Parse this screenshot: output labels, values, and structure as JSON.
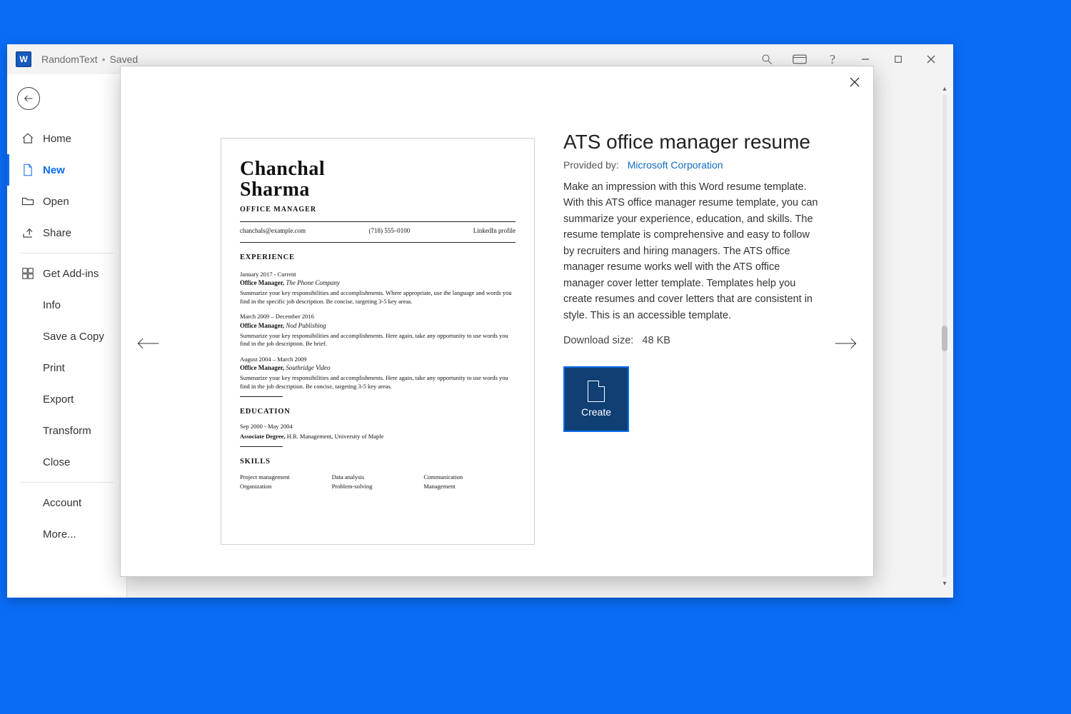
{
  "titlebar": {
    "app_initial": "W",
    "doc_name": "RandomText",
    "separator": "•",
    "save_state": "Saved"
  },
  "backstage": {
    "home": "Home",
    "new": "New",
    "open": "Open",
    "share": "Share",
    "get_addins": "Get Add-ins",
    "info": "Info",
    "save_copy": "Save a Copy",
    "print": "Print",
    "export": "Export",
    "transform": "Transform",
    "close": "Close",
    "account": "Account",
    "more": "More..."
  },
  "modal": {
    "title": "ATS office manager resume",
    "provided_label": "Provided by:",
    "provider": "Microsoft Corporation",
    "description": "Make an impression with this Word resume template. With this ATS office manager resume template, you can summarize your experience, education, and skills. The resume template is comprehensive and easy to follow by recruiters and hiring managers. The ATS office manager resume works well with the ATS office manager cover letter template. Templates help you create resumes and cover letters that are consistent in style. This is an accessible template.",
    "download_label": "Download size:",
    "download_size": "48 KB",
    "create_label": "Create"
  },
  "resume": {
    "name_line1": "Chanchal",
    "name_line2": "Sharma",
    "role": "OFFICE MANAGER",
    "contact_email": "chanchals@example.com",
    "contact_phone": "(718) 555–0100",
    "contact_linkedin": "LinkedIn profile",
    "section_experience": "EXPERIENCE",
    "jobs": [
      {
        "dates": "January 2017 - Current",
        "title_bold": "Office Manager,",
        "title_ital": "The Phone Company",
        "blurb": "Summarize your key responsibilities and accomplishments. Where appropriate, use the language and words you find in the specific job description. Be concise, targeting 3-5 key areas."
      },
      {
        "dates": "March 2009 – December 2016",
        "title_bold": "Office Manager,",
        "title_ital": "Nod Publishing",
        "blurb": "Summarize your key responsibilities and accomplishments. Here again, take any opportunity to use words you find in the job description. Be brief."
      },
      {
        "dates": "August 2004 – March 2009",
        "title_bold": "Office Manager,",
        "title_ital": "Southridge Video",
        "blurb": "Summarize your key responsibilities and accomplishments. Here again, take any opportunity to use words you find in the job description. Be concise, targeting 3-5 key areas."
      }
    ],
    "section_education": "EDUCATION",
    "edu_dates": "Sep 2000 - May 2004",
    "edu_degree_bold": "Associate Degree,",
    "edu_rest": " H.R. Management, University of Maple",
    "section_skills": "SKILLS",
    "skills": [
      "Project management",
      "Data analysis",
      "Communication",
      "Organization",
      "Problem-solving",
      "Management"
    ]
  }
}
